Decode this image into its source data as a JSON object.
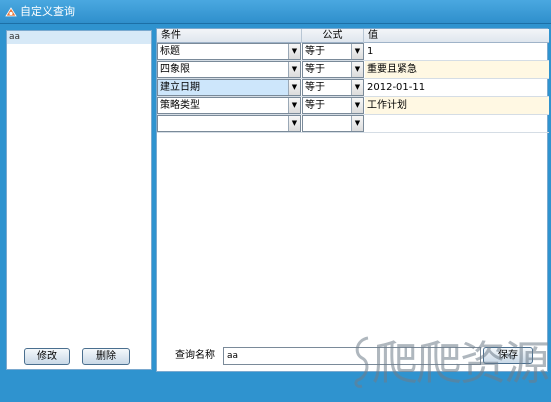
{
  "window": {
    "title": "自定义查询"
  },
  "left_list": {
    "items": [
      "aa"
    ]
  },
  "buttons": {
    "edit": "修改",
    "delete": "删除",
    "save": "保存"
  },
  "grid": {
    "headers": {
      "condition": "条件",
      "formula": "公式",
      "value": "值"
    },
    "rows": [
      {
        "condition": "标题",
        "formula": "等于",
        "value": "1"
      },
      {
        "condition": "四象限",
        "formula": "等于",
        "value": "重要且紧急"
      },
      {
        "condition": "建立日期",
        "formula": "等于",
        "value": "2012-01-11"
      },
      {
        "condition": "策略类型",
        "formula": "等于",
        "value": "工作计划"
      },
      {
        "condition": "",
        "formula": "",
        "value": ""
      }
    ]
  },
  "query": {
    "label": "查询名称",
    "value": "aa"
  },
  "watermark": {
    "text": "爬爬资源"
  },
  "colors": {
    "frame": "#2f93cf",
    "selected_combo": "#cde6fb",
    "value_tint": "#fff8e3"
  }
}
